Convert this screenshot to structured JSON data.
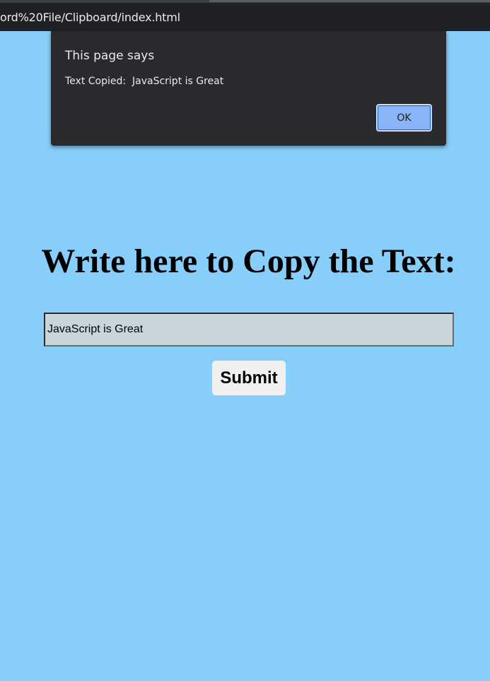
{
  "browser": {
    "url_text": "ord%20File/Clipboard/index.html"
  },
  "page": {
    "heading": "Write here to Copy the Text:",
    "input_value": "JavaScript is Great",
    "submit_label": "Submit"
  },
  "dialog": {
    "title": "This page says",
    "message": "Text Copied:  JavaScript is Great",
    "ok_label": "OK"
  },
  "colors": {
    "page_background": "#87cefa",
    "dialog_background": "#292a2d",
    "ok_button": "#8ab4f8",
    "input_background": "#c8d6dc"
  }
}
